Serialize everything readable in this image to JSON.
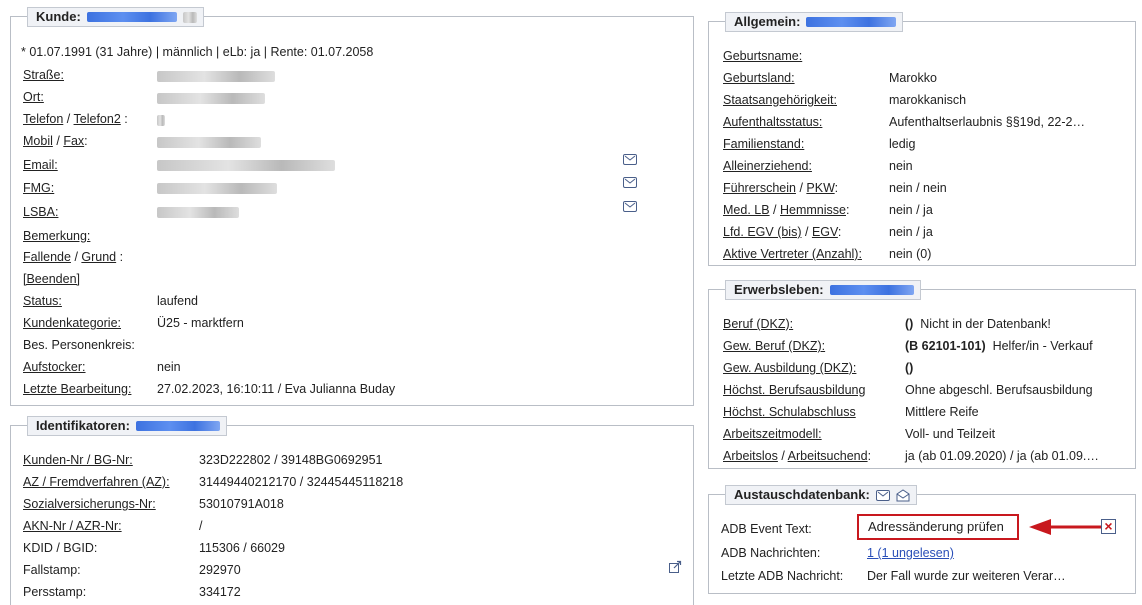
{
  "kunde": {
    "title": "Kunde:",
    "summary": "* 01.07.1991 (31 Jahre) | männlich | eLb: ja | Rente: 01.07.2058",
    "labels": {
      "strasse": "Straße:",
      "ort": "Ort:",
      "telefon": "Telefon",
      "telefon2": "Telefon2",
      "mobil": "Mobil",
      "fax": "Fax",
      "email": "Email:",
      "fmg": "FMG:",
      "lsba": "LSBA:",
      "bemerkung": "Bemerkung:",
      "fallende": "Fallende",
      "grund": "Grund",
      "beenden": "[Beenden]",
      "status": "Status:",
      "kundenkategorie": "Kundenkategorie:",
      "bes_personenkreis": "Bes. Personenkreis:",
      "aufstocker": "Aufstocker:",
      "letzte_bearbeitung": "Letzte Bearbeitung:"
    },
    "values": {
      "status": "laufend",
      "kundenkategorie": "Ü25 - marktfern",
      "aufstocker": "nein",
      "letzte_bearbeitung": "27.02.2023, 16:10:11 / Eva Julianna Buday"
    }
  },
  "identifikatoren": {
    "title": "Identifikatoren:",
    "rows": [
      {
        "label": "Kunden-Nr / BG-Nr:",
        "value": "323D222802 / 39148BG0692951"
      },
      {
        "label": "AZ / Fremdverfahren (AZ):",
        "value": "31449440212170 / 32445445118218"
      },
      {
        "label": "Sozialversicherungs-Nr:",
        "value": "53010791A018"
      },
      {
        "label": "AKN-Nr / AZR-Nr:",
        "value": "/"
      },
      {
        "label": "KDID / BGID:",
        "value": "115306 / 66029"
      },
      {
        "label": "Fallstamp:",
        "value": "292970"
      },
      {
        "label": "Persstamp:",
        "value": "334172"
      }
    ]
  },
  "allgemein": {
    "title": "Allgemein:",
    "rows": [
      {
        "label": "Geburtsname:",
        "value": ""
      },
      {
        "label": "Geburtsland:",
        "value": "Marokko"
      },
      {
        "label": "Staatsangehörigkeit:",
        "value": "marokkanisch"
      },
      {
        "label": "Aufenthaltsstatus:",
        "value": "Aufenthaltserlaubnis §§19d, 22-2…"
      },
      {
        "label": "Familienstand:",
        "value": "ledig"
      },
      {
        "label": "Alleinerziehend:",
        "value": "nein"
      },
      {
        "label": "Führerschein",
        "label2": "PKW",
        "value": "nein / nein"
      },
      {
        "label": "Med. LB",
        "label2": "Hemmnisse",
        "value": "nein / ja"
      },
      {
        "label": "Lfd. EGV (bis)",
        "label2": "EGV",
        "value": "nein / ja"
      },
      {
        "label": "Aktive Vertreter (Anzahl):",
        "value": "nein (0)"
      }
    ]
  },
  "erwerbsleben": {
    "title": "Erwerbsleben:",
    "rows": [
      {
        "label": "Beruf (DKZ):",
        "code": "()",
        "value": "Nicht in der Datenbank!"
      },
      {
        "label": "Gew. Beruf (DKZ):",
        "code": "(B 62101-101)",
        "value": "Helfer/in - Verkauf"
      },
      {
        "label": "Gew. Ausbildung (DKZ):",
        "code": "()",
        "value": ""
      },
      {
        "label": "Höchst. Berufsausbildung",
        "code": "",
        "value": "Ohne abgeschl. Berufsausbildung"
      },
      {
        "label": "Höchst. Schulabschluss",
        "code": "",
        "value": "Mittlere Reife"
      },
      {
        "label": "Arbeitszeitmodell:",
        "code": "",
        "value": "Voll- und Teilzeit"
      },
      {
        "label": "Arbeitslos",
        "label2": "Arbeitsuchend",
        "code": "",
        "value": "ja (ab 01.09.2020) / ja (ab 01.09.…"
      }
    ]
  },
  "austausch": {
    "title": "Austauschdatenbank:",
    "event_label": "ADB Event Text:",
    "event_value": "Adressänderung prüfen",
    "nachrichten_label": "ADB Nachrichten:",
    "nachrichten_value": "1 (1 ungelesen)",
    "letzte_label": "Letzte ADB Nachricht:",
    "letzte_value": "Der Fall wurde zur weiteren Verar…",
    "close_icon": "×"
  },
  "colors": {
    "accent_red": "#c8181e",
    "link_blue": "#2a4fb8",
    "border": "#b9bec6"
  }
}
